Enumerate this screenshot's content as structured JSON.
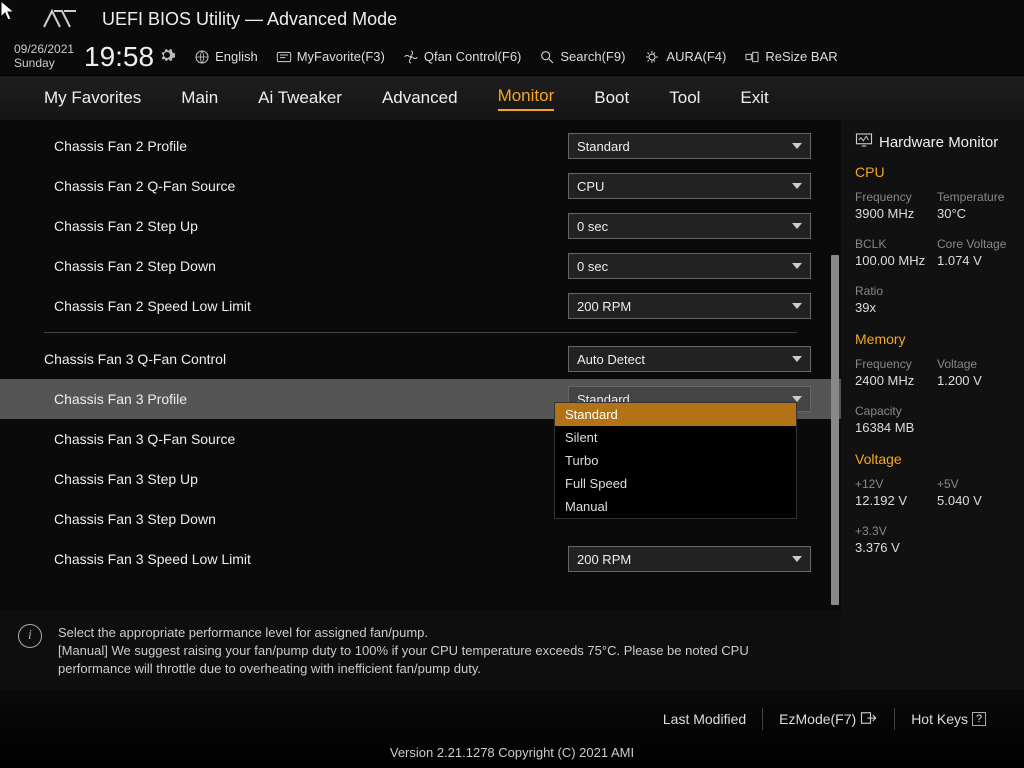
{
  "title": "UEFI BIOS Utility — Advanced Mode",
  "date": "09/26/2021",
  "day": "Sunday",
  "time": "19:58",
  "utils": {
    "lang": "English",
    "fav": "MyFavorite(F3)",
    "qfan": "Qfan Control(F6)",
    "search": "Search(F9)",
    "aura": "AURA(F4)",
    "resize": "ReSize BAR"
  },
  "tabs": [
    "My Favorites",
    "Main",
    "Ai Tweaker",
    "Advanced",
    "Monitor",
    "Boot",
    "Tool",
    "Exit"
  ],
  "rows": [
    {
      "lbl": "Chassis Fan 2 Profile",
      "val": "Standard"
    },
    {
      "lbl": "Chassis Fan 2 Q-Fan Source",
      "val": "CPU"
    },
    {
      "lbl": "Chassis Fan 2 Step Up",
      "val": "0 sec"
    },
    {
      "lbl": "Chassis Fan 2 Step Down",
      "val": "0 sec"
    },
    {
      "lbl": "Chassis Fan 2 Speed Low Limit",
      "val": "200 RPM"
    },
    {
      "lbl": "Chassis Fan 3 Q-Fan Control",
      "val": "Auto Detect"
    },
    {
      "lbl": "Chassis Fan 3 Profile",
      "val": "Standard"
    },
    {
      "lbl": "Chassis Fan 3 Q-Fan Source",
      "val": ""
    },
    {
      "lbl": "Chassis Fan 3 Step Up",
      "val": ""
    },
    {
      "lbl": "Chassis Fan 3 Step Down",
      "val": ""
    },
    {
      "lbl": "Chassis Fan 3 Speed Low Limit",
      "val": "200 RPM"
    }
  ],
  "dropdown_options": [
    "Standard",
    "Silent",
    "Turbo",
    "Full Speed",
    "Manual"
  ],
  "help1": "Select the appropriate performance level for assigned fan/pump.",
  "help2": "[Manual] We suggest raising your fan/pump duty to 100% if your CPU temperature exceeds 75°C. Please be noted CPU performance will throttle due to overheating with inefficient fan/pump duty.",
  "hw_title": "Hardware Monitor",
  "cpu": {
    "freq_k": "Frequency",
    "freq_v": "3900 MHz",
    "temp_k": "Temperature",
    "temp_v": "30°C",
    "bclk_k": "BCLK",
    "bclk_v": "100.00 MHz",
    "cv_k": "Core Voltage",
    "cv_v": "1.074 V",
    "ratio_k": "Ratio",
    "ratio_v": "39x"
  },
  "mem": {
    "freq_k": "Frequency",
    "freq_v": "2400 MHz",
    "volt_k": "Voltage",
    "volt_v": "1.200 V",
    "cap_k": "Capacity",
    "cap_v": "16384 MB"
  },
  "volt": {
    "v12_k": "+12V",
    "v12_v": "12.192 V",
    "v5_k": "+5V",
    "v5_v": "5.040 V",
    "v33_k": "+3.3V",
    "v33_v": "3.376 V"
  },
  "sect_cpu": "CPU",
  "sect_mem": "Memory",
  "sect_volt": "Voltage",
  "footer": {
    "last": "Last Modified",
    "ez": "EzMode(F7)",
    "hot": "Hot Keys",
    "ver": "Version 2.21.1278 Copyright (C) 2021 AMI"
  }
}
